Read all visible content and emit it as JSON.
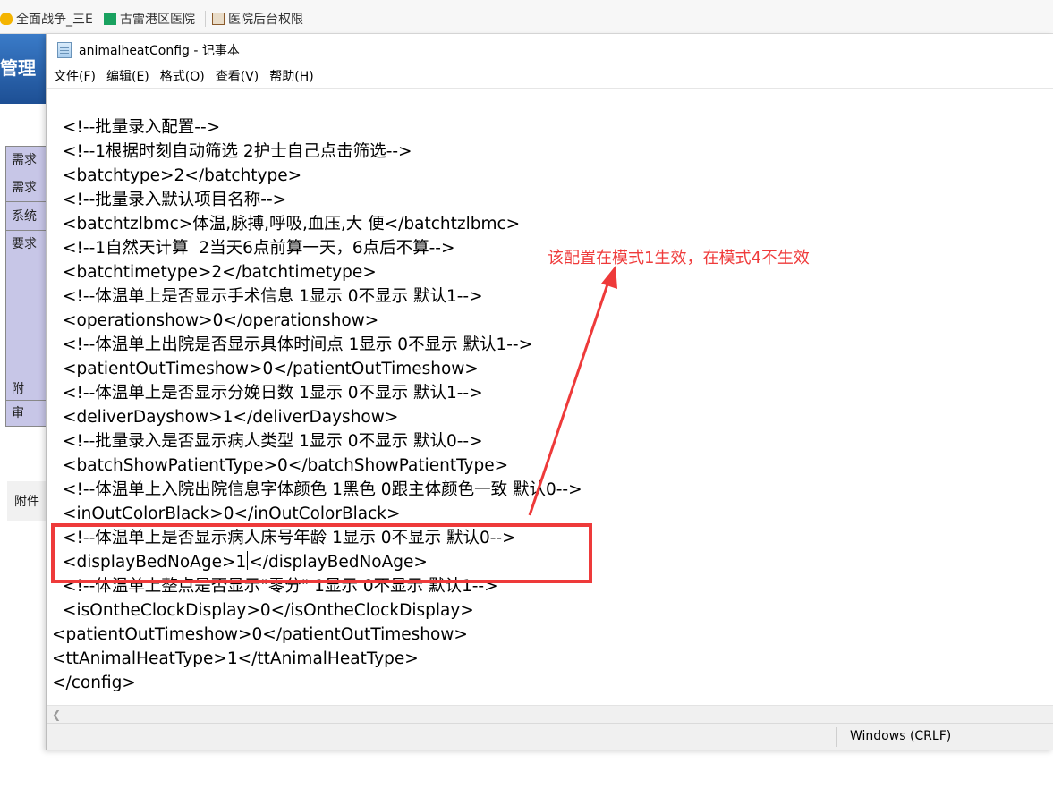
{
  "browser": {
    "bookmarks": [
      {
        "label": "全面战争_三E",
        "icon": "bulb-icon",
        "color": "#f4b400"
      },
      {
        "label": "古雷港区医院",
        "icon": "sheet-icon",
        "color": "#1aa260"
      },
      {
        "label": "医院后台权限",
        "icon": "picture-icon",
        "color": "#8a5a2b"
      }
    ]
  },
  "background_page": {
    "banner_text": "管理",
    "table_cells": [
      "需求",
      "需求",
      "系统",
      "要求",
      "附",
      "审"
    ],
    "attachment_label": "附件"
  },
  "notepad": {
    "title": "animalheatConfig - 记事本",
    "menu": [
      "文件(F)",
      "编辑(E)",
      "格式(O)",
      "查看(V)",
      "帮助(H)"
    ],
    "lines": [
      "<!--批量录入配置-->",
      "<!--1根据时刻自动筛选 2护士自己点击筛选-->",
      "<batchtype>2</batchtype>",
      "<!--批量录入默认项目名称-->",
      "<batchtzlbmc>体温,脉搏,呼吸,血压,大 便</batchtzlbmc>",
      "<!--1自然天计算  2当天6点前算一天，6点后不算-->",
      "<batchtimetype>2</batchtimetype>",
      "<!--体温单上是否显示手术信息 1显示 0不显示 默认1-->",
      "<operationshow>0</operationshow>",
      "<!--体温单上出院是否显示具体时间点 1显示 0不显示 默认1-->",
      "<patientOutTimeshow>0</patientOutTimeshow>",
      "<!--体温单上是否显示分娩日数 1显示 0不显示 默认1-->",
      "<deliverDayshow>1</deliverDayshow>",
      "<!--批量录入是否显示病人类型 1显示 0不显示 默认0-->",
      "<batchShowPatientType>0</batchShowPatientType>",
      "<!--体温单上入院出院信息字体颜色 1黑色 0跟主体颜色一致 默认0-->",
      "<inOutColorBlack>0</inOutColorBlack>",
      "<!--体温单上是否显示病人床号年龄 1显示 0不显示 默认0-->",
      "<displayBedNoAge>1",
      "<!--体温单上整点是否显示\"零分\" 1显示 0不显示 默认1-->",
      "<isOntheClockDisplay>0</isOntheClockDisplay>",
      "<patientOutTimeshow>0</patientOutTimeshow>",
      "<ttAnimalHeatType>1</ttAnimalHeatType>",
      "</config>"
    ],
    "caret_line_tail": "</displayBedNoAge>",
    "status_encoding": "Windows (CRLF)"
  },
  "annotation": {
    "text": "该配置在模式1生效，在模式4不生效",
    "color": "#ee3a3a"
  }
}
